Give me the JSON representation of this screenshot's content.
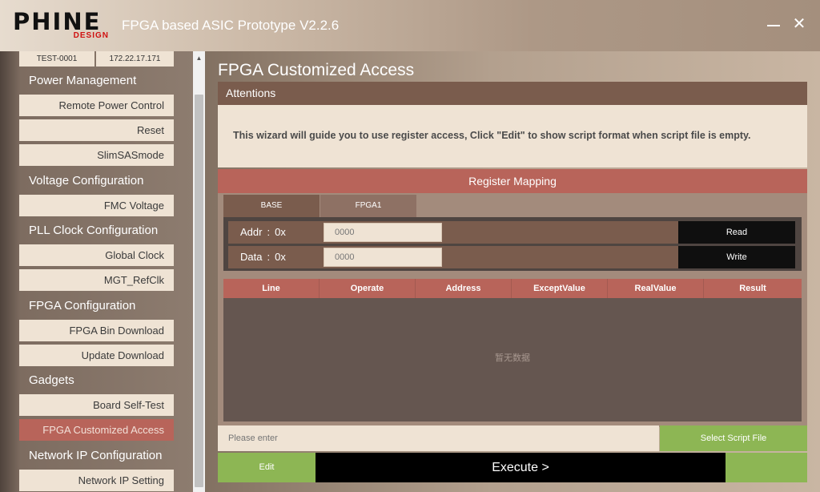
{
  "app": {
    "logo_main": "PHINE",
    "logo_sub": "DESIGN",
    "title": "FPGA based ASIC Prototype V2.2.6",
    "close_glyph": "✕"
  },
  "connection": {
    "device": "TEST-0001",
    "ip": "172.22.17.171"
  },
  "sidebar": {
    "groups": [
      {
        "label": "Power Management",
        "items": [
          "Remote Power Control",
          "Reset",
          "SlimSASmode"
        ]
      },
      {
        "label": "Voltage Configuration",
        "items": [
          "FMC Voltage"
        ]
      },
      {
        "label": "PLL Clock Configuration",
        "items": [
          "Global Clock",
          "MGT_RefClk"
        ]
      },
      {
        "label": "FPGA Configuration",
        "items": [
          "FPGA Bin Download",
          "Update Download"
        ]
      },
      {
        "label": "Gadgets",
        "items": [
          "Board Self-Test",
          "FPGA Customized Access"
        ]
      },
      {
        "label": "Network IP Configuration",
        "items": [
          "Network IP Setting"
        ]
      }
    ],
    "active_item": "FPGA Customized Access"
  },
  "scrollbar": {
    "up_glyph": "▲"
  },
  "main": {
    "title": "FPGA Customized Access",
    "attentions": {
      "header": "Attentions",
      "message": "This wizard will guide you to use register access, Click \"Edit\" to show script format when script file is empty."
    },
    "register": {
      "header": "Register Mapping",
      "tabs": [
        "BASE",
        "FPGA1"
      ],
      "addr": {
        "label": "Addr",
        "colon": ":",
        "prefix": "0x",
        "value": "0000"
      },
      "data": {
        "label": "Data",
        "colon": ":",
        "prefix": "0x",
        "value": "0000"
      },
      "read_label": "Read",
      "write_label": "Write",
      "columns": [
        "Line",
        "Operate",
        "Address",
        "ExceptValue",
        "RealValue",
        "Result"
      ],
      "empty_text": "暂无数据"
    },
    "script": {
      "placeholder": "Please enter",
      "select_label": "Select Script File"
    },
    "edit_label": "Edit",
    "execute_label": "Execute >"
  }
}
